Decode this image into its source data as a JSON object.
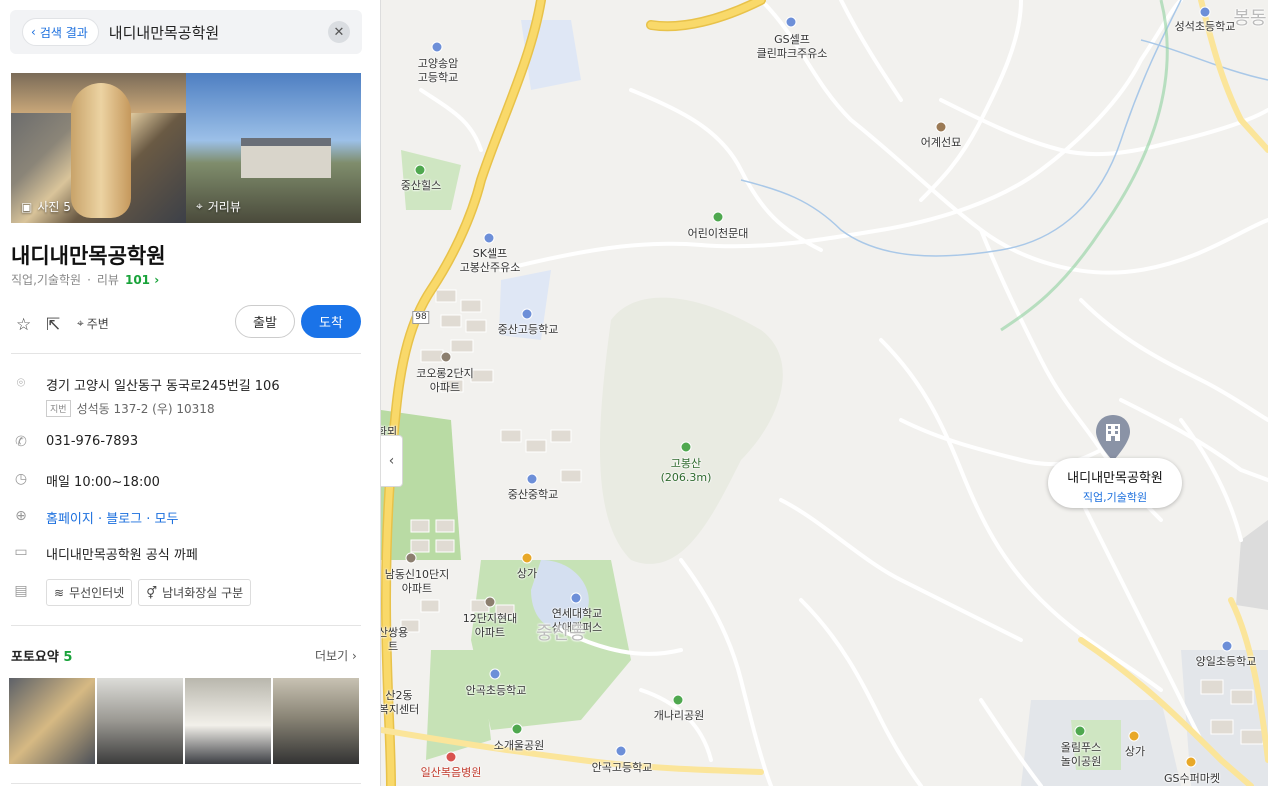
{
  "search": {
    "back_label": "검색 결과",
    "query": "내디내만목공학원"
  },
  "photos": {
    "main_label": "사진 5",
    "street_label": "거리뷰"
  },
  "place": {
    "name": "내디내만목공학원",
    "category": "직업,기술학원",
    "review_label": "리뷰",
    "review_count": "101"
  },
  "actions": {
    "nearby_label": "주변",
    "start_label": "출발",
    "arrive_label": "도착"
  },
  "info": {
    "address": "경기 고양시 일산동구 동국로245번길 106",
    "jibun_tag": "지번",
    "jibun": "성석동 137-2 (우) 10318",
    "phone": "031-976-7893",
    "hours": "매일 10:00~18:00",
    "links": "홈페이지 · 블로그 · 모두",
    "channel": "내디내만목공학원 공식 까페",
    "amenity1": "무선인터넷",
    "amenity2": "남녀화장실 구분"
  },
  "photo_summary": {
    "title": "포토요약",
    "count": "5",
    "more_label": "더보기"
  },
  "map": {
    "labels": {
      "songam_hs": "고양송암\n고등학교",
      "gs_clean": "GS셀프\n클린파크주유소",
      "seongseok_es": "성석초등학교",
      "bongdong": "봉동",
      "eogyeseon": "어계선묘",
      "jungsan_hills": "중산힐스",
      "observatory": "어린이천문대",
      "sk_self": "SK셀프\n고봉산주유소",
      "jungsan_hs": "중산고등학교",
      "kolon": "코오롱2단지\n아파트",
      "gobongsan": "고봉산\n(206.3m)",
      "jungsan_ms": "중산중학교",
      "namdong": "남동신10단지\n아파트",
      "shop1": "상가",
      "hyundai12": "12단지현대\n아파트",
      "yonsei": "연세대학교\n삼애캠퍼스",
      "jungsandong": "중산동",
      "sanssang": "산쌍용\n트",
      "welfare": "산2동\n복지센터",
      "angok_es": "안곡초등학교",
      "gaenari": "개나리공원",
      "sogaeul": "소개울공원",
      "ilsan_hosp": "일산복음병원",
      "angok_hs": "안곡고등학교",
      "yangil_es": "양일초등학교",
      "olrim_park": "올림푸스\n놀이공원",
      "shop2": "상가",
      "gs_super": "GS수퍼마켓",
      "rt98": "98",
      "hwaryeo": "화뫼"
    },
    "marker": {
      "title": "내디내만목공학원",
      "subtitle": "직업,기술학원"
    }
  },
  "colors": {
    "accent": "#1a73e8",
    "green_count": "#19a33a",
    "road_major": "#f9d96a",
    "map_bg": "#f2f1ee",
    "park": "#c8e3b8"
  }
}
